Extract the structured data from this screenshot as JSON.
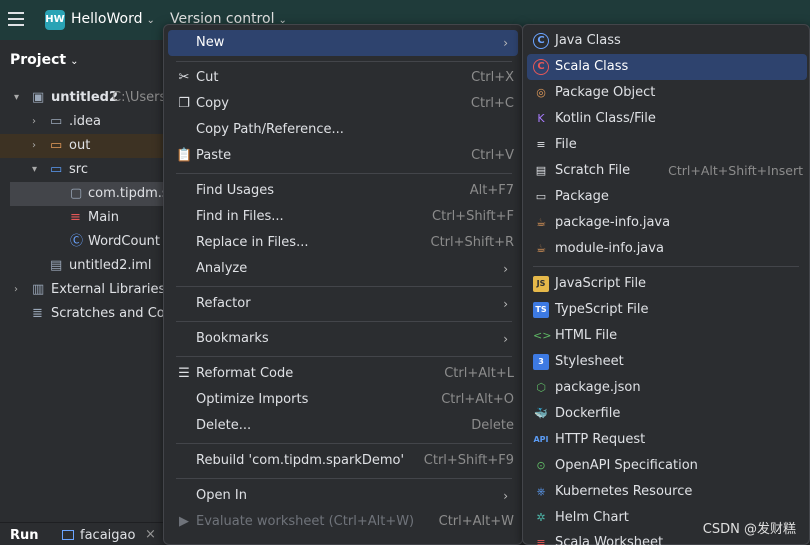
{
  "titlebar": {
    "project_badge": "HW",
    "project_name": "HelloWord",
    "vcs_label": "Version control",
    "chevron": "⌄"
  },
  "tool_window": {
    "title": "Project",
    "chevron": "⌄"
  },
  "tree": [
    {
      "label": "untitled2",
      "path": "C:\\Users\\",
      "icon": "module-folder-icon"
    },
    {
      "label": ".idea",
      "icon": "folder-icon"
    },
    {
      "label": "out",
      "icon": "folder-icon"
    },
    {
      "label": "src",
      "icon": "folder-icon"
    },
    {
      "label": "com.tipdm.s",
      "icon": "package-icon"
    },
    {
      "label": "Main",
      "icon": "scala-icon"
    },
    {
      "label": "WordCount",
      "icon": "class-icon"
    },
    {
      "label": "untitled2.iml",
      "icon": "file-icon"
    },
    {
      "label": "External Libraries",
      "icon": "libraries-icon"
    },
    {
      "label": "Scratches and Con",
      "icon": "scratches-icon"
    }
  ],
  "bottom": {
    "run_label": "Run",
    "tab_label": "facaigao",
    "close": "×"
  },
  "menu": {
    "items": [
      {
        "label": "New",
        "shortcut": "",
        "submenu": true
      },
      {
        "label": "Cut",
        "shortcut": "Ctrl+X"
      },
      {
        "label": "Copy",
        "shortcut": "Ctrl+C"
      },
      {
        "label": "Copy Path/Reference...",
        "shortcut": ""
      },
      {
        "label": "Paste",
        "shortcut": "Ctrl+V"
      },
      {
        "label": "Find Usages",
        "shortcut": "Alt+F7"
      },
      {
        "label": "Find in Files...",
        "shortcut": "Ctrl+Shift+F"
      },
      {
        "label": "Replace in Files...",
        "shortcut": "Ctrl+Shift+R"
      },
      {
        "label": "Analyze",
        "shortcut": "",
        "submenu": true
      },
      {
        "label": "Refactor",
        "shortcut": "",
        "submenu": true
      },
      {
        "label": "Bookmarks",
        "shortcut": "",
        "submenu": true
      },
      {
        "label": "Reformat Code",
        "shortcut": "Ctrl+Alt+L"
      },
      {
        "label": "Optimize Imports",
        "shortcut": "Ctrl+Alt+O"
      },
      {
        "label": "Delete...",
        "shortcut": "Delete"
      },
      {
        "label": "Rebuild 'com.tipdm.sparkDemo'",
        "shortcut": "Ctrl+Shift+F9"
      },
      {
        "label": "Open In",
        "shortcut": "",
        "submenu": true
      },
      {
        "label": "Evaluate worksheet (Ctrl+Alt+W)",
        "shortcut": "Ctrl+Alt+W",
        "disabled": true
      }
    ],
    "submenu_arrow": "›"
  },
  "submenu": {
    "items": [
      {
        "label": "Java Class",
        "icon": "java-class-icon",
        "glyph": "C"
      },
      {
        "label": "Scala Class",
        "icon": "scala-class-icon",
        "glyph": "C"
      },
      {
        "label": "Package Object",
        "icon": "package-object-icon",
        "glyph": "◎"
      },
      {
        "label": "Kotlin Class/File",
        "icon": "kotlin-icon",
        "glyph": "K"
      },
      {
        "label": "File",
        "icon": "file-icon",
        "glyph": "≡"
      },
      {
        "label": "Scratch File",
        "icon": "scratch-file-icon",
        "glyph": "▤",
        "shortcut": "Ctrl+Alt+Shift+Insert"
      },
      {
        "label": "Package",
        "icon": "package-icon",
        "glyph": "▭"
      },
      {
        "label": "package-info.java",
        "icon": "java-file-icon",
        "glyph": "☕"
      },
      {
        "label": "module-info.java",
        "icon": "java-file-icon",
        "glyph": "☕"
      },
      {
        "label": "JavaScript File",
        "icon": "javascript-icon",
        "glyph": "JS"
      },
      {
        "label": "TypeScript File",
        "icon": "typescript-icon",
        "glyph": "TS"
      },
      {
        "label": "HTML File",
        "icon": "html-icon",
        "glyph": "<>"
      },
      {
        "label": "Stylesheet",
        "icon": "css-icon",
        "glyph": "3"
      },
      {
        "label": "package.json",
        "icon": "nodejs-icon",
        "glyph": "⬡"
      },
      {
        "label": "Dockerfile",
        "icon": "docker-icon",
        "glyph": "🐳"
      },
      {
        "label": "HTTP Request",
        "icon": "api-icon",
        "glyph": "API"
      },
      {
        "label": "OpenAPI Specification",
        "icon": "openapi-icon",
        "glyph": "⊙"
      },
      {
        "label": "Kubernetes Resource",
        "icon": "kubernetes-icon",
        "glyph": "⎈"
      },
      {
        "label": "Helm Chart",
        "icon": "helm-icon",
        "glyph": "✲"
      },
      {
        "label": "Scala Worksheet",
        "icon": "scala-worksheet-icon",
        "glyph": "≡"
      }
    ]
  },
  "watermark": "CSDN @发财糕"
}
